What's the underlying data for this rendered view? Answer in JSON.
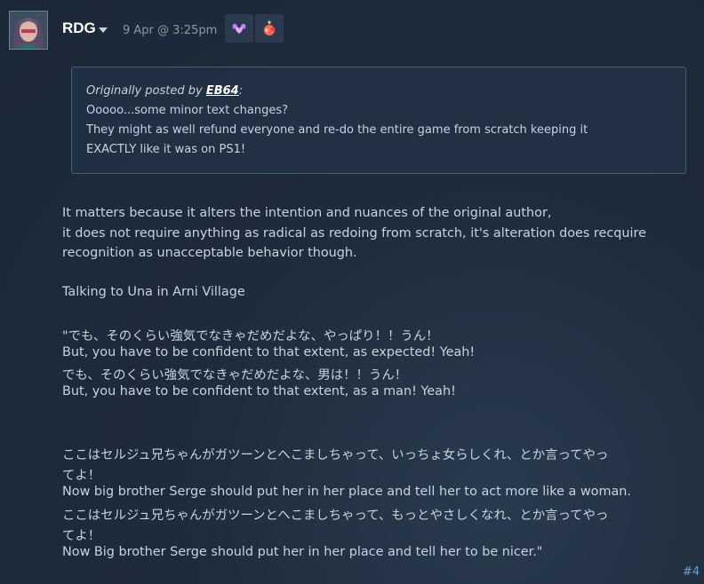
{
  "author": {
    "name": "RDG",
    "timestamp": "9 Apr @ 3:25pm"
  },
  "awards": [
    {
      "icon": "purple-heart-hands-award-icon",
      "color": "#c77dff"
    },
    {
      "icon": "fire-sparkle-award-icon",
      "color": "#ff6a4a"
    }
  ],
  "quote": {
    "prefix": "Originally posted by ",
    "author": "EB64",
    "suffix": ":",
    "lines": [
      "Ooooo...some minor text changes?",
      "They might as well refund everyone and re-do the entire game from scratch keeping it",
      "EXACTLY like it was on PS1!"
    ]
  },
  "body": {
    "lines": [
      "It matters because it alters the intention and nuances of the original author,",
      "it does not require anything as radical as redoing from scratch, it's alteration does recquire",
      "recognition as unacceptable behavior though.",
      "Talking to Una in Arni Village",
      "\"でも、そのくらい強気でなきゃだめだよな、やっぱり！！うん！",
      "But, you have to be confident to that extent, as expected! Yeah!",
      "でも、そのくらい強気でなきゃだめだよな、男は！！うん！",
      "But, you have to be confident to that extent, as a man! Yeah!",
      "ここはセルジュ兄ちゃんがガツーンとへこましちゃって、いっちょ女らしくれ、とか言ってやっ",
      "てよ！",
      "Now big brother Serge should put her in her place and tell her to act more like a woman.",
      "ここはセルジュ兄ちゃんがガツーンとへこましちゃって、もっとやさしくなれ、とか言ってやっ",
      "てよ！",
      "Now Big brother Serge should put her in her place and tell her to be nicer.\""
    ]
  },
  "post_number": "#4",
  "colors": {
    "background": "#1b2838",
    "text": "#c6d4df",
    "link": "#6a9fd6",
    "muted": "#8f98a0"
  }
}
